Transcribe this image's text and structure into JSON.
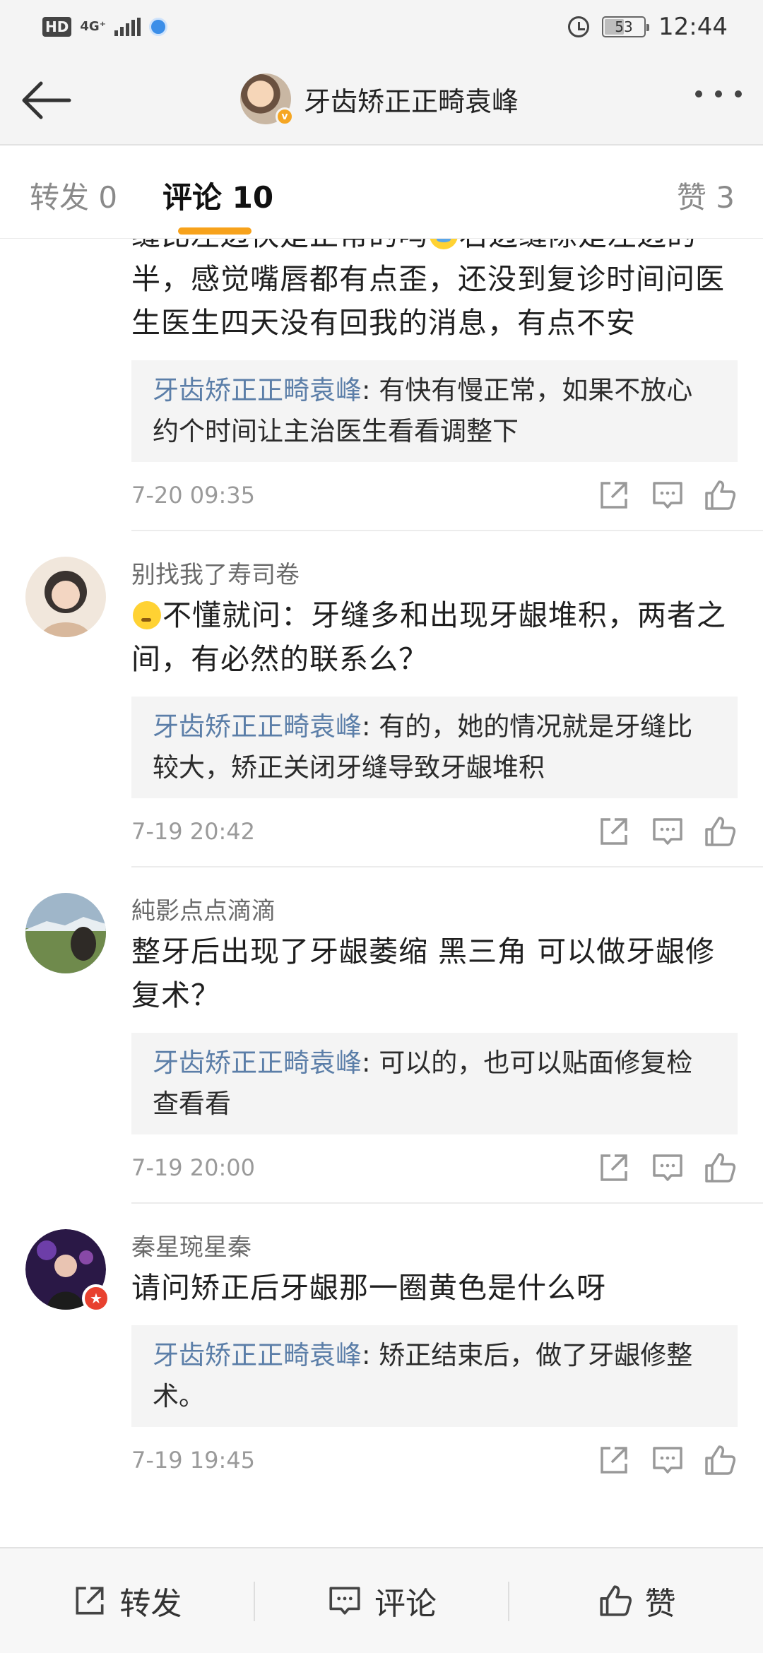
{
  "status_bar": {
    "hd": "HD",
    "network": "4G⁺",
    "battery": "53",
    "battery_level": 0.53,
    "time": "12:44"
  },
  "header": {
    "title": "牙齿矫正正畸袁峰",
    "verified_badge": "v",
    "icons": [
      "arrow-left-icon",
      "more-dots-icon"
    ]
  },
  "tabs": [
    {
      "label": "转发 0"
    },
    {
      "label": "评论 10",
      "active": true
    },
    {
      "label": "赞 3"
    }
  ],
  "accent_color": "#f7a21b",
  "link_color": "#5b7ea8",
  "comments": [
    {
      "user": "",
      "text_before": "缝比左边快是正常的吗",
      "emoji": "crying-face-icon",
      "text_after": "右边缝隙是左边的一半，感觉嘴唇都有点歪，还没到复诊时间问医生医生四天没有回我的消息，有点不安",
      "reply_name": "牙齿矫正正畸袁峰",
      "reply_text": ": 有快有慢正常，如果不放心约个时间让主治医生看看调整下",
      "time": "7-20 09:35"
    },
    {
      "user": "别找我了寿司卷",
      "text_before": "",
      "emoji": "thinking-face-icon",
      "text_after": "不懂就问：牙缝多和出现牙龈堆积，两者之间，有必然的联系么？",
      "reply_name": "牙齿矫正正畸袁峰",
      "reply_text": ": 有的，她的情况就是牙缝比较大，矫正关闭牙缝导致牙龈堆积",
      "time": "7-19 20:42"
    },
    {
      "user": "純影点点滴滴",
      "text_before": "整牙后出现了牙龈萎缩 黑三角 可以做牙龈修复术？",
      "emoji": "",
      "text_after": "",
      "reply_name": "牙齿矫正正畸袁峰",
      "reply_text": ": 可以的，也可以贴面修复检查看看",
      "time": "7-19 20:00"
    },
    {
      "user": "秦星琬星秦",
      "text_before": "请问矫正后牙龈那一圈黄色是什么呀",
      "emoji": "",
      "text_after": "",
      "reply_name": "牙齿矫正正畸袁峰",
      "reply_text": ": 矫正结束后，做了牙龈修整术。",
      "time": "7-19 19:45"
    }
  ],
  "bottom_bar": {
    "forward": "转发",
    "comment": "评论",
    "like": "赞"
  }
}
